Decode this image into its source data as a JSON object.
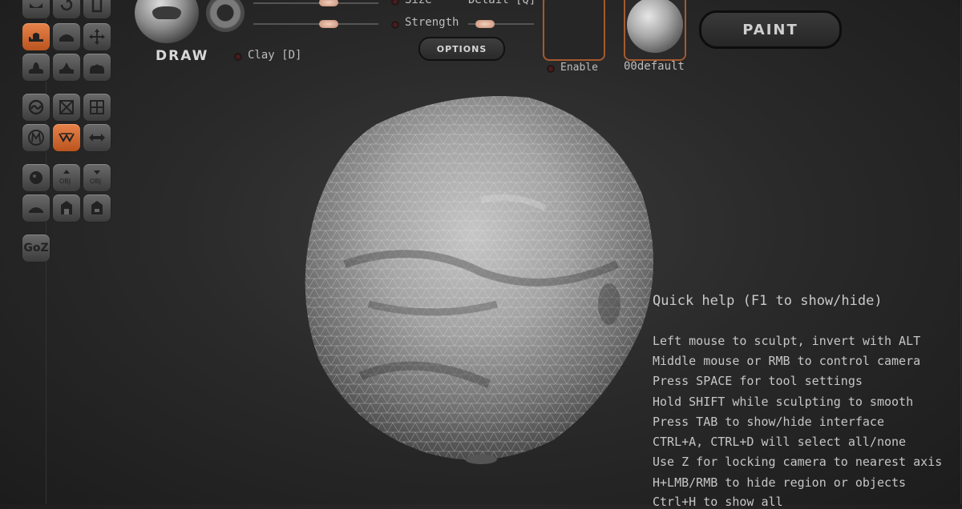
{
  "toolbar": {
    "goz_label": "GoZ"
  },
  "brush": {
    "name": "DRAW",
    "alt_brush": "Clay [D]",
    "size_label": "Size",
    "strength_label": "Strength",
    "detail_label": "Detail [Q]",
    "size_value": 0.6,
    "strength_value": 0.6,
    "detail_value": 0.25
  },
  "options_label": "OPTIONS",
  "color": {
    "enable_label": "Enable",
    "value": "#262626"
  },
  "material": {
    "name": "00default"
  },
  "paint_label": "PAINT",
  "help": {
    "title": "Quick help (F1 to show/hide)",
    "lines": [
      "Left mouse to sculpt, invert with ALT",
      "Middle mouse or RMB to control camera",
      "Press SPACE for tool settings",
      "Hold SHIFT while sculpting to smooth",
      "Press TAB to show/hide interface",
      "CTRL+A, CTRL+D will select all/none",
      "Use Z for locking camera to nearest axis",
      "H+LMB/RMB to hide region or objects",
      "Ctrl+H to show all"
    ]
  },
  "colors": {
    "accent": "#d8703a",
    "background": "#2a2a2a"
  }
}
